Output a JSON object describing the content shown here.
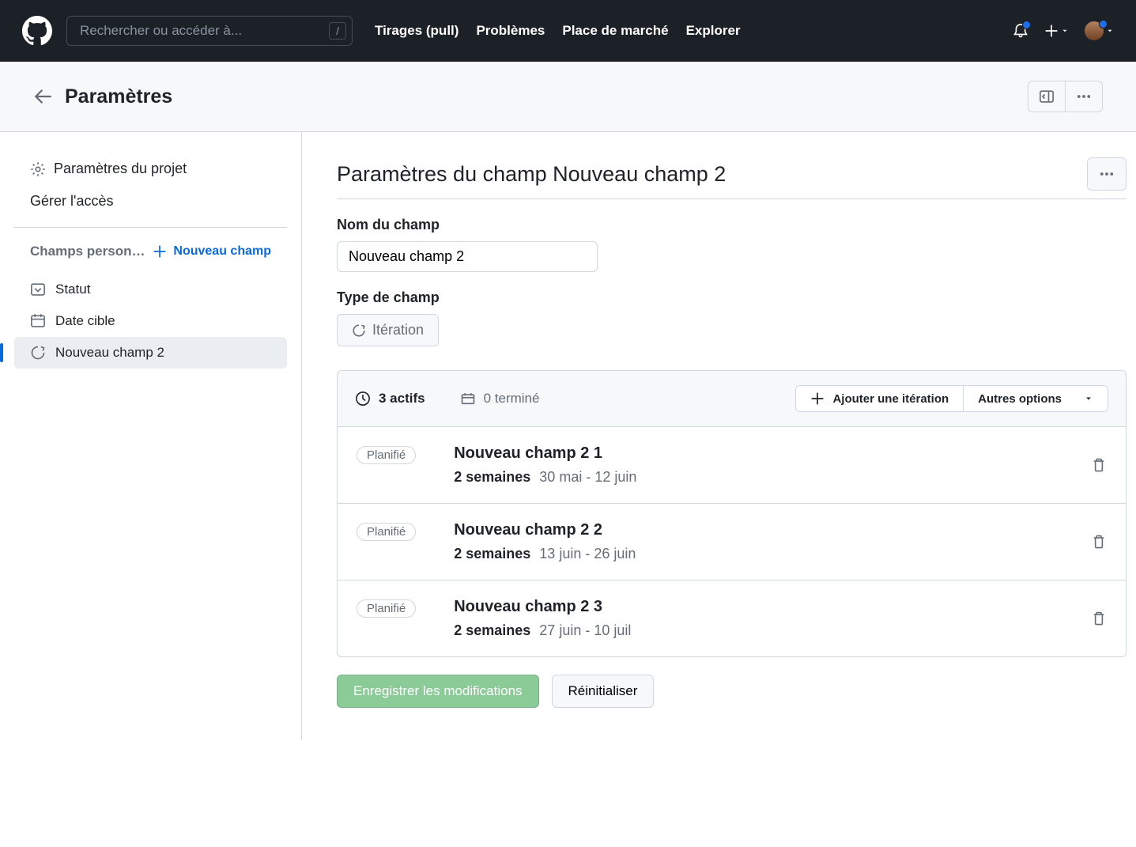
{
  "topbar": {
    "search_placeholder": "Rechercher ou accéder à...",
    "slash": "/",
    "links": [
      "Tirages (pull)",
      "Problèmes",
      "Place de marché",
      "Explorer"
    ]
  },
  "subheader": {
    "title": "Paramètres"
  },
  "sidebar": {
    "project_settings": "Paramètres du projet",
    "manage_access": "Gérer l'accès",
    "custom_fields_label": "Champs person…",
    "new_field_label": "Nouveau champ",
    "fields": [
      {
        "label": "Statut"
      },
      {
        "label": "Date cible"
      },
      {
        "label": "Nouveau champ 2"
      }
    ]
  },
  "main": {
    "heading": "Paramètres du champ Nouveau champ 2",
    "field_name_label": "Nom du champ",
    "field_name_value": "Nouveau champ 2",
    "field_type_label": "Type de champ",
    "field_type_value": "Itération",
    "iterations": {
      "active_count": "3 actifs",
      "completed_count": "0 terminé",
      "add_label": "Ajouter une itération",
      "other_options_label": "Autres options",
      "rows": [
        {
          "badge": "Planifié",
          "title": "Nouveau champ 2 1",
          "duration": "2 semaines",
          "dates": "30 mai - 12 juin"
        },
        {
          "badge": "Planifié",
          "title": "Nouveau champ 2 2",
          "duration": "2 semaines",
          "dates": "13 juin - 26 juin"
        },
        {
          "badge": "Planifié",
          "title": "Nouveau champ 2 3",
          "duration": "2 semaines",
          "dates": "27 juin - 10 juil"
        }
      ]
    },
    "save_label": "Enregistrer les modifications",
    "reset_label": "Réinitialiser"
  }
}
